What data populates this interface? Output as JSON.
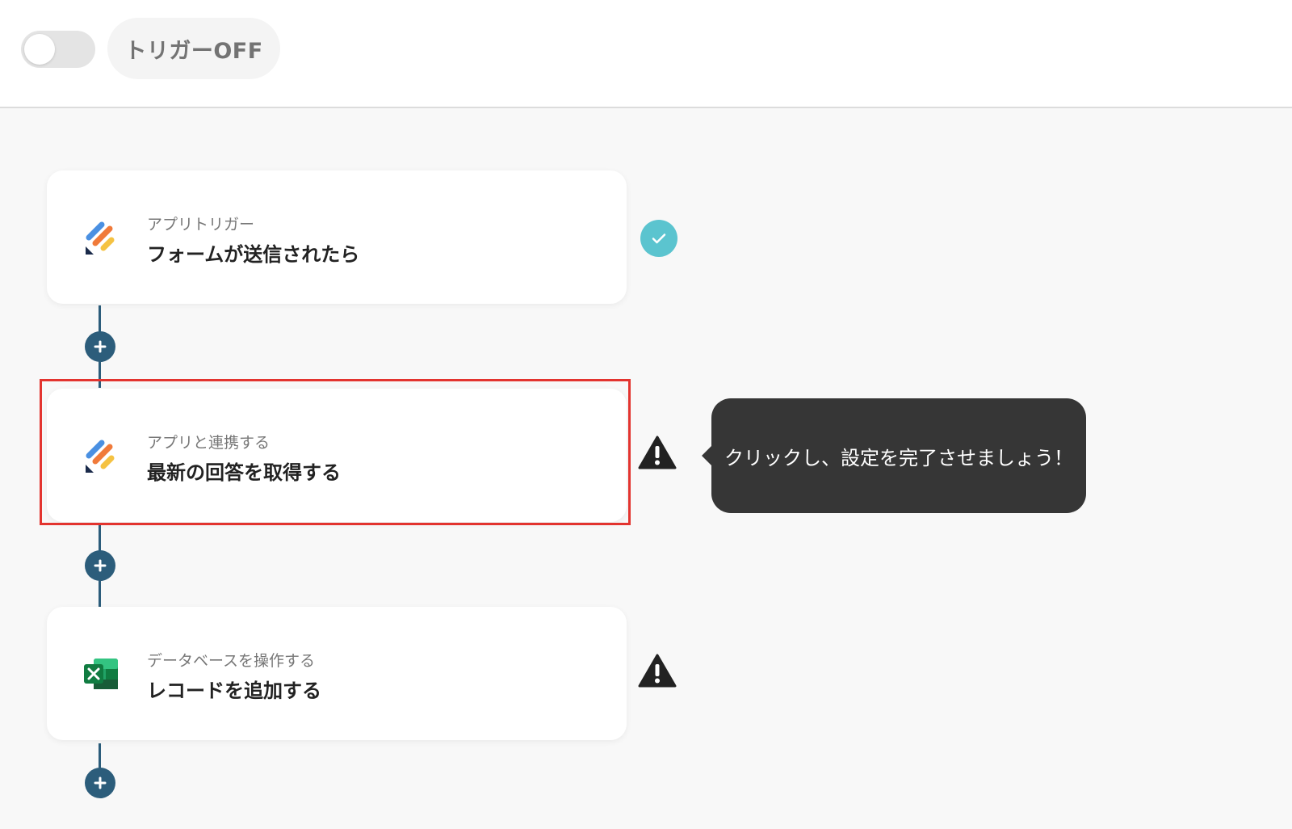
{
  "header": {
    "trigger_toggle": {
      "state": "off"
    },
    "trigger_status_label": "トリガーOFF"
  },
  "flow": {
    "steps": [
      {
        "category": "アプリトリガー",
        "title": "フォームが送信されたら",
        "app_icon": "form-app-icon",
        "status": "complete"
      },
      {
        "category": "アプリと連携する",
        "title": "最新の回答を取得する",
        "app_icon": "form-app-icon",
        "status": "warning"
      },
      {
        "category": "データベースを操作する",
        "title": "レコードを追加する",
        "app_icon": "excel-icon",
        "status": "warning"
      }
    ],
    "tooltip_text": "クリックし、設定を完了させましょう！"
  },
  "colors": {
    "timeline": "#2c5d7b",
    "complete": "#5bc4cf",
    "warning": "#222222",
    "highlight": "#e3342f",
    "tooltip_bg": "#363636"
  }
}
